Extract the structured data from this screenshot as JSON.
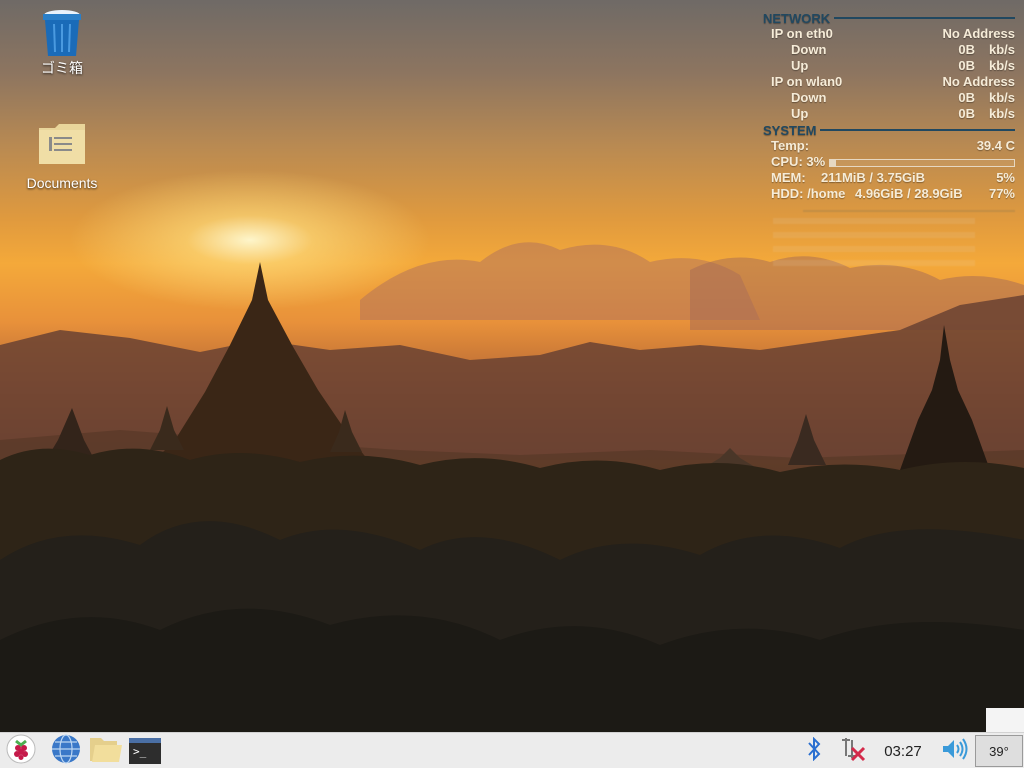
{
  "desktop": {
    "icons": [
      {
        "label": "ゴミ箱",
        "icon": "trash-icon"
      },
      {
        "label": "Documents",
        "icon": "folder-icon"
      }
    ]
  },
  "conky": {
    "network": {
      "title": "NETWORK",
      "eth0": {
        "label": "IP on eth0",
        "address": "No Address",
        "down": {
          "label": "Down",
          "value": "0B",
          "unit": "kb/s"
        },
        "up": {
          "label": "Up",
          "value": "0B",
          "unit": "kb/s"
        }
      },
      "wlan0": {
        "label": "IP on wlan0",
        "address": "No Address",
        "down": {
          "label": "Down",
          "value": "0B",
          "unit": "kb/s"
        },
        "up": {
          "label": "Up",
          "value": "0B",
          "unit": "kb/s"
        }
      }
    },
    "system": {
      "title": "SYSTEM",
      "temp": {
        "label": "Temp:",
        "value": "39.4 C"
      },
      "cpu": {
        "label": "CPU: 3%",
        "percent": 3
      },
      "mem": {
        "label": "MEM:",
        "value": "211MiB  / 3.75GiB",
        "percent": "5%"
      },
      "hdd": {
        "label": "HDD: /home",
        "value": "4.96GiB / 28.9GiB",
        "percent": "77%"
      }
    }
  },
  "taskbar": {
    "left": [
      "raspberry-menu-icon",
      "web-browser-icon",
      "file-manager-icon",
      "terminal-icon"
    ],
    "terminal_glyph": ">_",
    "clock": "03:27",
    "cpu_temp": "39°"
  },
  "colors": {
    "conky_heading": "#214860",
    "conky_text": "#f6ecd8",
    "taskbar_bg": "#ececec",
    "bluetooth": "#2a6fd0",
    "network_error": "#d42a4a"
  }
}
